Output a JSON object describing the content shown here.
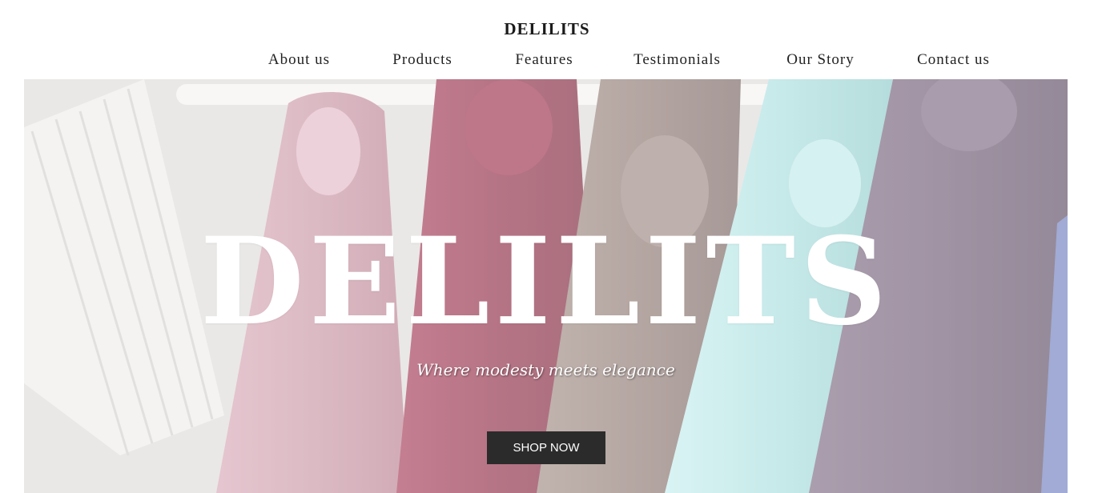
{
  "header": {
    "brand": "DELILITS",
    "nav": [
      {
        "label": "About us"
      },
      {
        "label": "Products"
      },
      {
        "label": "Features"
      },
      {
        "label": "Testimonials"
      },
      {
        "label": "Our Story"
      },
      {
        "label": "Contact us"
      }
    ]
  },
  "hero": {
    "title": "DELILITS",
    "tagline": "Where modesty meets elegance",
    "cta_label": "SHOP NOW"
  },
  "colors": {
    "background": "#ffffff",
    "text": "#1a1a1a",
    "button_bg": "#2b2b2b",
    "button_text": "#ffffff",
    "scarf_pink": "#c996a4",
    "scarf_red": "#8e2a44",
    "scarf_taupe": "#8d7770",
    "scarf_mint": "#a9dede",
    "scarf_purple": "#6e5a73"
  }
}
